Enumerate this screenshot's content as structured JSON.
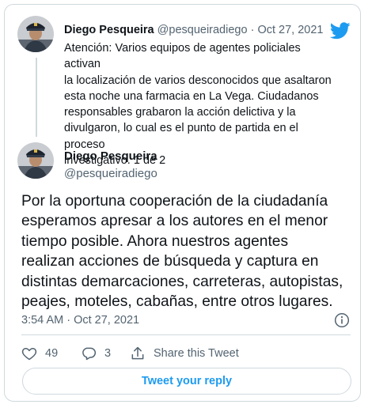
{
  "parent_tweet": {
    "display_name": "Diego Pesqueira",
    "handle": "@pesqueiradiego",
    "separator": "·",
    "date": "Oct 27, 2021",
    "text": "Atención: Varios equipos de agentes policiales activan\nla localización de varios desconocidos que asaltaron\nesta noche una farmacia en La Vega. Ciudadanos\nresponsables grabaron la acción delictiva y la\ndivulgaron, lo cual es el punto de partida en el proceso\ninvestigativo. 1 de 2"
  },
  "main_tweet": {
    "display_name": "Diego Pesqueira",
    "handle": "@pesqueiradiego",
    "text": "Por la oportuna cooperación de la ciudadanía\nesperamos apresar a los autores en el menor\ntiempo posible. Ahora nuestros agentes\nrealizan acciones de búsqueda y captura en\ndistintas demarcaciones, carreteras, autopistas,\npeajes, moteles, cabañas, entre otros lugares.",
    "timestamp": "3:54 AM · Oct 27, 2021"
  },
  "actions": {
    "likes": "49",
    "replies": "3",
    "share_label": "Share this Tweet"
  },
  "reply_button_label": "Tweet your reply",
  "colors": {
    "accent": "#1d9bf0",
    "muted": "#536471",
    "border": "#cfd9de",
    "text": "#0f1419"
  },
  "icons": [
    "twitter-bird-icon",
    "info-icon",
    "heart-icon",
    "reply-icon",
    "share-icon"
  ]
}
